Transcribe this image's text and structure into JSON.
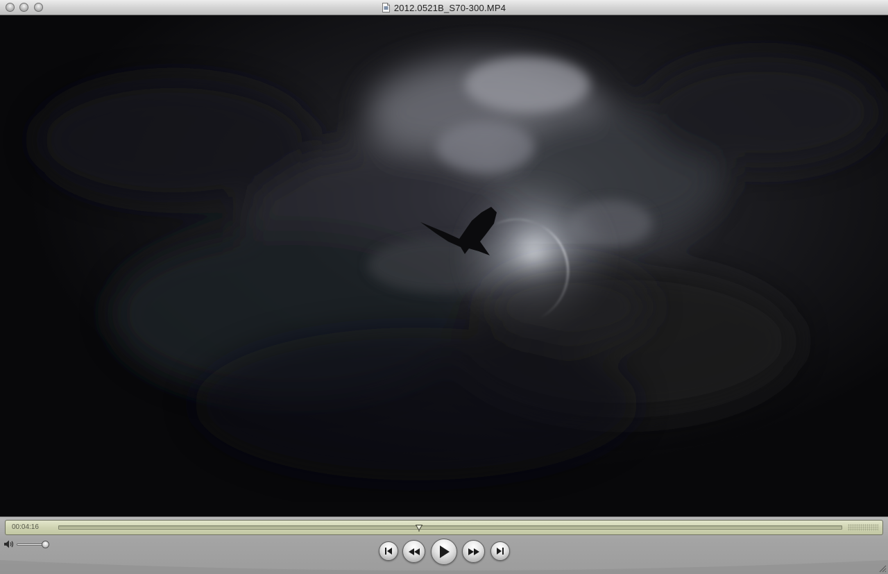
{
  "window": {
    "title": "2012.0521B_S70-300.MP4"
  },
  "icons": {
    "title_doc": "movie-document-icon",
    "volume": "speaker-icon",
    "go_to_start": "skip-to-start-icon",
    "rewind": "rewind-icon",
    "play": "play-icon",
    "fast_forward": "fast-forward-icon",
    "go_to_end": "skip-to-end-icon"
  },
  "controller": {
    "timecode": "00:04:16",
    "playback_progress": 0.46,
    "volume_level": 1.0
  },
  "colors": {
    "lcd": "#cfd3b2",
    "chrome": "#a8a8a8",
    "video_bg": "#0e0e10"
  }
}
